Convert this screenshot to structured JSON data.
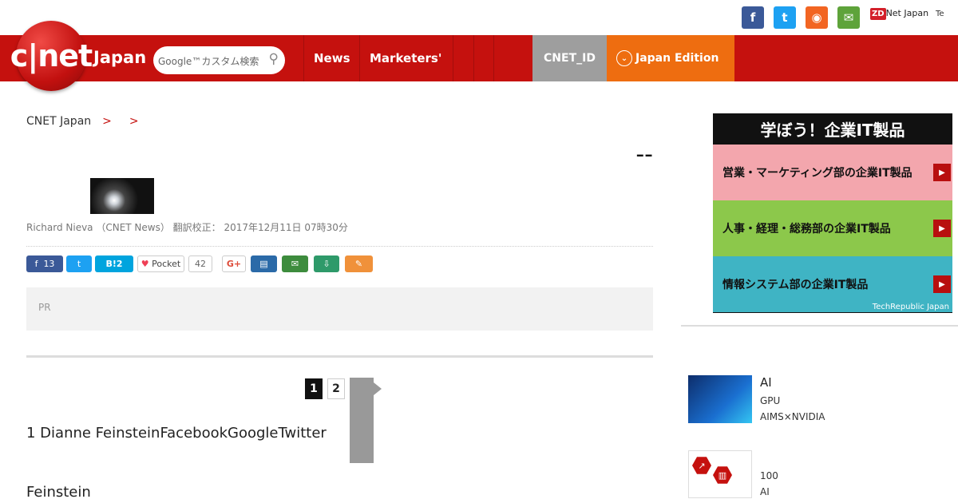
{
  "topbar": {
    "social": [
      "facebook",
      "twitter",
      "rss",
      "mail"
    ],
    "zdnet": "ZDNet Japan",
    "zd": "ZD",
    "techrepublic": "Te"
  },
  "nav": {
    "logo": "c|net",
    "logo_sub": "Japan",
    "search_placeholder": "Google™カスタム検索",
    "items": [
      "News",
      "Marketers'",
      "",
      "",
      ""
    ],
    "cnet_id": "CNET_ID",
    "edition": "Japan Edition"
  },
  "breadcrumb": {
    "home": "CNET Japan",
    "level1": "",
    "level2": ""
  },
  "article": {
    "title": "--",
    "byline": "Richard Nieva （CNET News） 翻訳校正： 2017年12月11日 07時30分",
    "share": {
      "facebook_count": "13",
      "hatena_count": "2",
      "pocket_label": "Pocket",
      "pocket_count": "42",
      "gplus": "G+"
    },
    "pr_tag": "PR",
    "pr_text": "",
    "pages": [
      "1",
      "2"
    ],
    "body1": "1 Dianne FeinsteinFacebookGoogleTwitter",
    "body2": "Feinstein"
  },
  "sidebar": {
    "ad_title": "学ぼう！企業IT製品",
    "ad_rows": [
      "営業・マーケティング部の企業IT製品",
      "人事・経理・総務部の企業IT製品",
      "情報システム部の企業IT製品"
    ],
    "ad_footer": "TechRepublic Japan",
    "section_title": "",
    "items": [
      {
        "headline": "AI",
        "sub1": "GPU",
        "sub2": "AIMS×NVIDIA"
      },
      {
        "headline": "",
        "sub1": "100",
        "sub2": "AI"
      }
    ]
  },
  "colors": {
    "brand_red": "#c5110e",
    "edition_orange": "#ee6d10",
    "cnetid_gray": "#9e9e9e"
  }
}
